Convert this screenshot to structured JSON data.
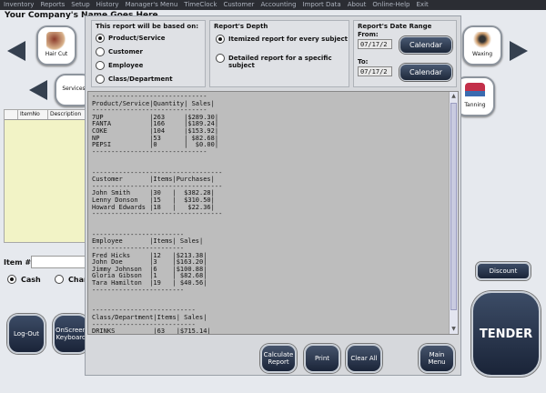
{
  "menubar": [
    "Inventory",
    "Reports",
    "Setup",
    "History",
    "Manager's Menu",
    "TimeClock",
    "Customer",
    "Accounting",
    "Import Data",
    "About",
    "Online-Help",
    "Exit"
  ],
  "company_name": "Your Company's Name Goes Here",
  "categories": {
    "hair_cut": "Hair Cut",
    "waxing": "Waxing",
    "services": "Services",
    "tanning": "Tanning"
  },
  "item_table": {
    "headers": [
      "ItemNo",
      "Description"
    ]
  },
  "item_label": "Item #",
  "payment": {
    "cash": "Cash",
    "charge": "Char"
  },
  "buttons": {
    "logout": "Log-Out",
    "onscreen": "OnScreen Keyboard",
    "discount": "Discount",
    "tender": "TENDER"
  },
  "report_dialog": {
    "basis": {
      "title": "This report will be based on:",
      "options": [
        "Product/Service",
        "Customer",
        "Employee",
        "Class/Department"
      ],
      "selected": 0
    },
    "depth": {
      "title": "Report's Depth",
      "options": [
        "Itemized report for every subject",
        "Detailed report for a specific subject"
      ],
      "selected": 0
    },
    "date_range": {
      "title": "Report's Date Range",
      "from_label": "From:",
      "to_label": "To:",
      "from_value": "07/17/2",
      "to_value": "07/17/2",
      "calendar_label": "Calendar"
    },
    "report_text": "------------------------------\nProduct/Service|Quantity| Sales|\n------------------------------\n7UP            |263     |$289.30|\nFANTA          |166     |$189.24|\nCOKE           |104     |$153.92|\nNP             |53      | $82.68|\nPEPSI          |0       |  $0.00|\n------------------------------\n\n\n----------------------------------\nCustomer       |Items|Purchases|\n----------------------------------\nJohn Smith     |30   |  $382.28|\nLenny Donson   |15   |  $310.50|\nHoward Edwards |18   |   $22.36|\n----------------------------------\n\n\n------------------------\nEmployee       |Items| Sales|\n------------------------\nFred Hicks     |12   |$213.38|\nJohn Doe       |3    |$163.20|\nJimmy Johnson  |6    |$100.88|\nGloria Gibson  |1    | $82.68|\nTara Hamilton  |19   | $40.56|\n------------------------\n\n\n---------------------------\nClass/Department|Items| Sales|\n---------------------------\nDRINKS          |63   |$715.14|\n---------------------------",
    "actions": {
      "calculate": "Calculate Report",
      "print": "Print",
      "clear": "Clear All",
      "main": "Main Menu"
    }
  }
}
